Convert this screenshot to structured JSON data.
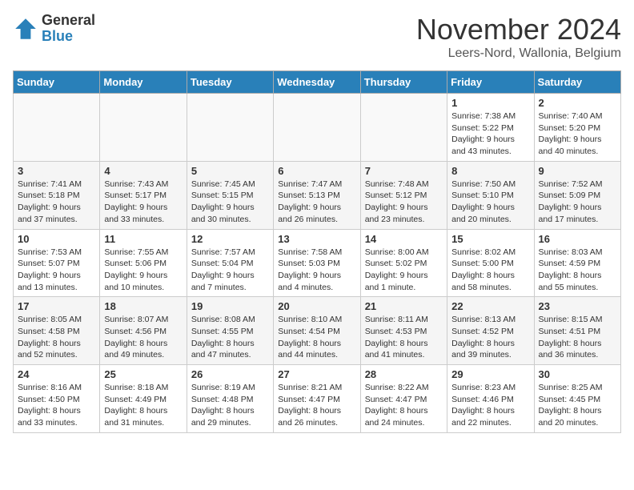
{
  "header": {
    "logo_general": "General",
    "logo_blue": "Blue",
    "month_title": "November 2024",
    "location": "Leers-Nord, Wallonia, Belgium"
  },
  "weekdays": [
    "Sunday",
    "Monday",
    "Tuesday",
    "Wednesday",
    "Thursday",
    "Friday",
    "Saturday"
  ],
  "weeks": [
    [
      {
        "day": "",
        "info": ""
      },
      {
        "day": "",
        "info": ""
      },
      {
        "day": "",
        "info": ""
      },
      {
        "day": "",
        "info": ""
      },
      {
        "day": "",
        "info": ""
      },
      {
        "day": "1",
        "info": "Sunrise: 7:38 AM\nSunset: 5:22 PM\nDaylight: 9 hours\nand 43 minutes."
      },
      {
        "day": "2",
        "info": "Sunrise: 7:40 AM\nSunset: 5:20 PM\nDaylight: 9 hours\nand 40 minutes."
      }
    ],
    [
      {
        "day": "3",
        "info": "Sunrise: 7:41 AM\nSunset: 5:18 PM\nDaylight: 9 hours\nand 37 minutes."
      },
      {
        "day": "4",
        "info": "Sunrise: 7:43 AM\nSunset: 5:17 PM\nDaylight: 9 hours\nand 33 minutes."
      },
      {
        "day": "5",
        "info": "Sunrise: 7:45 AM\nSunset: 5:15 PM\nDaylight: 9 hours\nand 30 minutes."
      },
      {
        "day": "6",
        "info": "Sunrise: 7:47 AM\nSunset: 5:13 PM\nDaylight: 9 hours\nand 26 minutes."
      },
      {
        "day": "7",
        "info": "Sunrise: 7:48 AM\nSunset: 5:12 PM\nDaylight: 9 hours\nand 23 minutes."
      },
      {
        "day": "8",
        "info": "Sunrise: 7:50 AM\nSunset: 5:10 PM\nDaylight: 9 hours\nand 20 minutes."
      },
      {
        "day": "9",
        "info": "Sunrise: 7:52 AM\nSunset: 5:09 PM\nDaylight: 9 hours\nand 17 minutes."
      }
    ],
    [
      {
        "day": "10",
        "info": "Sunrise: 7:53 AM\nSunset: 5:07 PM\nDaylight: 9 hours\nand 13 minutes."
      },
      {
        "day": "11",
        "info": "Sunrise: 7:55 AM\nSunset: 5:06 PM\nDaylight: 9 hours\nand 10 minutes."
      },
      {
        "day": "12",
        "info": "Sunrise: 7:57 AM\nSunset: 5:04 PM\nDaylight: 9 hours\nand 7 minutes."
      },
      {
        "day": "13",
        "info": "Sunrise: 7:58 AM\nSunset: 5:03 PM\nDaylight: 9 hours\nand 4 minutes."
      },
      {
        "day": "14",
        "info": "Sunrise: 8:00 AM\nSunset: 5:02 PM\nDaylight: 9 hours\nand 1 minute."
      },
      {
        "day": "15",
        "info": "Sunrise: 8:02 AM\nSunset: 5:00 PM\nDaylight: 8 hours\nand 58 minutes."
      },
      {
        "day": "16",
        "info": "Sunrise: 8:03 AM\nSunset: 4:59 PM\nDaylight: 8 hours\nand 55 minutes."
      }
    ],
    [
      {
        "day": "17",
        "info": "Sunrise: 8:05 AM\nSunset: 4:58 PM\nDaylight: 8 hours\nand 52 minutes."
      },
      {
        "day": "18",
        "info": "Sunrise: 8:07 AM\nSunset: 4:56 PM\nDaylight: 8 hours\nand 49 minutes."
      },
      {
        "day": "19",
        "info": "Sunrise: 8:08 AM\nSunset: 4:55 PM\nDaylight: 8 hours\nand 47 minutes."
      },
      {
        "day": "20",
        "info": "Sunrise: 8:10 AM\nSunset: 4:54 PM\nDaylight: 8 hours\nand 44 minutes."
      },
      {
        "day": "21",
        "info": "Sunrise: 8:11 AM\nSunset: 4:53 PM\nDaylight: 8 hours\nand 41 minutes."
      },
      {
        "day": "22",
        "info": "Sunrise: 8:13 AM\nSunset: 4:52 PM\nDaylight: 8 hours\nand 39 minutes."
      },
      {
        "day": "23",
        "info": "Sunrise: 8:15 AM\nSunset: 4:51 PM\nDaylight: 8 hours\nand 36 minutes."
      }
    ],
    [
      {
        "day": "24",
        "info": "Sunrise: 8:16 AM\nSunset: 4:50 PM\nDaylight: 8 hours\nand 33 minutes."
      },
      {
        "day": "25",
        "info": "Sunrise: 8:18 AM\nSunset: 4:49 PM\nDaylight: 8 hours\nand 31 minutes."
      },
      {
        "day": "26",
        "info": "Sunrise: 8:19 AM\nSunset: 4:48 PM\nDaylight: 8 hours\nand 29 minutes."
      },
      {
        "day": "27",
        "info": "Sunrise: 8:21 AM\nSunset: 4:47 PM\nDaylight: 8 hours\nand 26 minutes."
      },
      {
        "day": "28",
        "info": "Sunrise: 8:22 AM\nSunset: 4:47 PM\nDaylight: 8 hours\nand 24 minutes."
      },
      {
        "day": "29",
        "info": "Sunrise: 8:23 AM\nSunset: 4:46 PM\nDaylight: 8 hours\nand 22 minutes."
      },
      {
        "day": "30",
        "info": "Sunrise: 8:25 AM\nSunset: 4:45 PM\nDaylight: 8 hours\nand 20 minutes."
      }
    ]
  ]
}
